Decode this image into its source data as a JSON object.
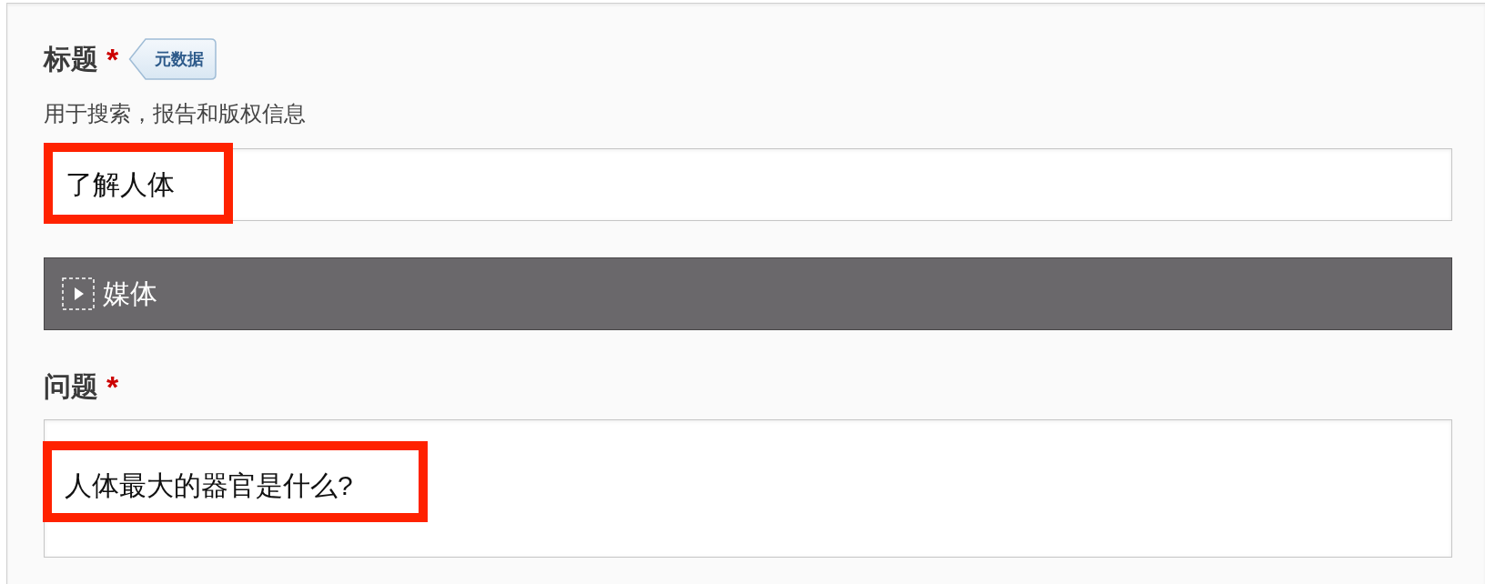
{
  "title_field": {
    "label": "标题",
    "required_mark": "*",
    "tag": "元数据",
    "description": "用于搜索，报告和版权信息",
    "value": "了解人体",
    "highlighted": true
  },
  "media_section": {
    "label": "媒体",
    "expanded": false
  },
  "question_field": {
    "label": "问题",
    "required_mark": "*",
    "value": "人体最大的器官是什么?",
    "highlighted": true
  }
}
